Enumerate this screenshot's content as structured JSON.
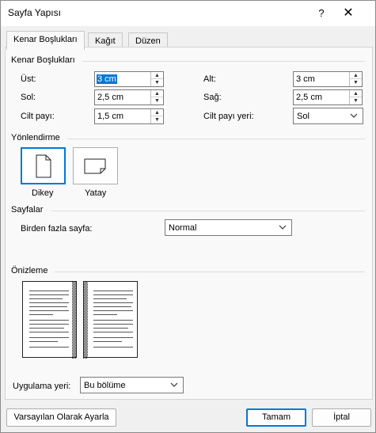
{
  "window": {
    "title": "Sayfa Yapısı",
    "help": "?",
    "close": "✕"
  },
  "tabs": [
    "Kenar Boşlukları",
    "Kağıt",
    "Düzen"
  ],
  "margins": {
    "group_label": "Kenar Boşlukları",
    "top_label": "Üst:",
    "top_value": "3 cm",
    "bottom_label": "Alt:",
    "bottom_value": "3 cm",
    "left_label": "Sol:",
    "left_value": "2,5 cm",
    "right_label": "Sağ:",
    "right_value": "2,5 cm",
    "gutter_label": "Cilt payı:",
    "gutter_value": "1,5 cm",
    "gutter_pos_label": "Cilt payı yeri:",
    "gutter_pos_value": "Sol"
  },
  "orientation": {
    "group_label": "Yönlendirme",
    "portrait": "Dikey",
    "landscape": "Yatay",
    "selected": "portrait"
  },
  "pages": {
    "group_label": "Sayfalar",
    "multiple_label": "Birden fazla sayfa:",
    "multiple_value": "Normal"
  },
  "preview": {
    "group_label": "Önizleme"
  },
  "apply": {
    "label": "Uygulama yeri:",
    "value": "Bu bölüme"
  },
  "buttons": {
    "default": "Varsayılan Olarak Ayarla",
    "ok": "Tamam",
    "cancel": "İptal"
  },
  "colors": {
    "accent": "#0078d7"
  }
}
